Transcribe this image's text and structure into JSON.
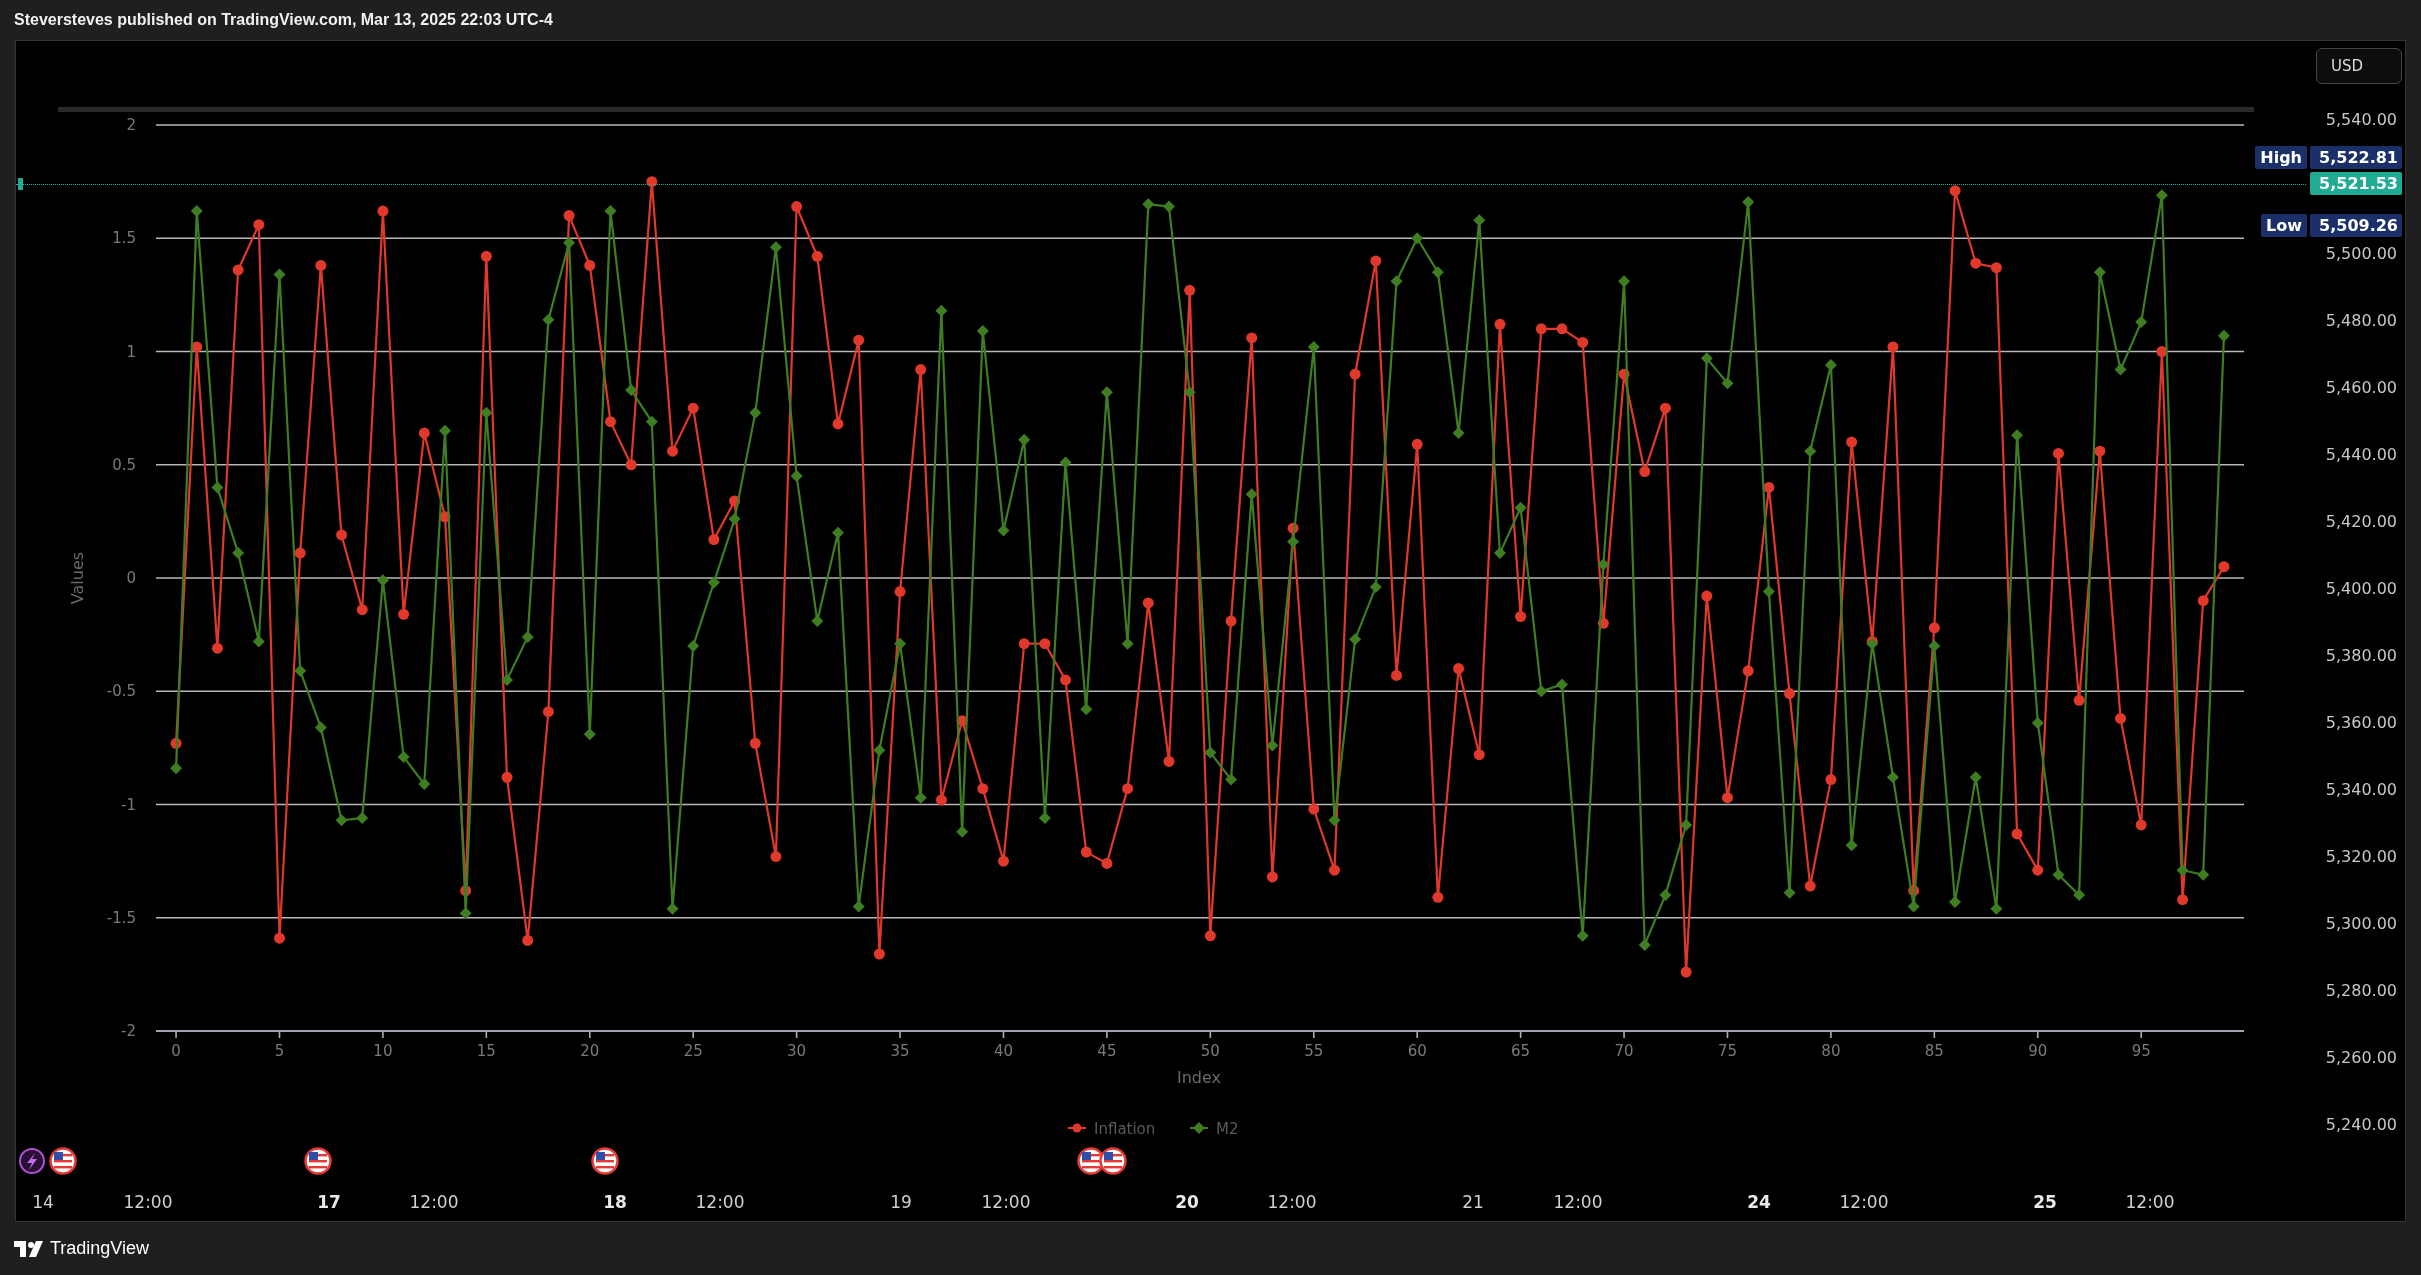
{
  "header": {
    "published": "Steversteves published on TradingView.com, Mar 13, 2025 22:03 UTC-4"
  },
  "chart": {
    "chart_data": {
      "type": "line",
      "xlabel": "Index",
      "ylabel": "Values",
      "xlim": [
        -0.97,
        99.97
      ],
      "ylim": [
        -2,
        2
      ],
      "grid": true,
      "legend": "bottom",
      "x": [
        0,
        1,
        2,
        3,
        4,
        5,
        6,
        7,
        8,
        9,
        10,
        11,
        12,
        13,
        14,
        15,
        16,
        17,
        18,
        19,
        20,
        21,
        22,
        23,
        24,
        25,
        26,
        27,
        28,
        29,
        30,
        31,
        32,
        33,
        34,
        35,
        36,
        37,
        38,
        39,
        40,
        41,
        42,
        43,
        44,
        45,
        46,
        47,
        48,
        49,
        50,
        51,
        52,
        53,
        54,
        55,
        56,
        57,
        58,
        59,
        60,
        61,
        62,
        63,
        64,
        65,
        66,
        67,
        68,
        69,
        70,
        71,
        72,
        73,
        74,
        75,
        76,
        77,
        78,
        79,
        80,
        81,
        82,
        83,
        84,
        85,
        86,
        87,
        88,
        89,
        90,
        91,
        92,
        93,
        94,
        95,
        96,
        97,
        98,
        99
      ],
      "xticks": [
        0,
        5,
        10,
        15,
        20,
        25,
        30,
        35,
        40,
        45,
        50,
        55,
        60,
        65,
        70,
        75,
        80,
        85,
        90,
        95
      ],
      "yticks": [
        -2,
        -1.5,
        -1,
        -0.5,
        0,
        0.5,
        1,
        1.5,
        2
      ],
      "series": [
        {
          "name": "Inflation",
          "color": "#e0392b",
          "marker": "circle",
          "values": [
            -0.73,
            1.02,
            -0.31,
            1.36,
            1.56,
            -1.59,
            0.11,
            1.38,
            0.19,
            -0.14,
            1.62,
            -0.16,
            0.64,
            0.27,
            -1.38,
            1.42,
            -0.88,
            -1.6,
            -0.59,
            1.6,
            1.38,
            0.69,
            0.5,
            1.75,
            0.56,
            0.75,
            0.17,
            0.34,
            -0.73,
            -1.23,
            1.64,
            1.42,
            0.68,
            1.05,
            -1.66,
            -0.06,
            0.92,
            -0.98,
            -0.63,
            -0.93,
            -1.25,
            -0.29,
            -0.29,
            -0.45,
            -1.21,
            -1.26,
            -0.93,
            -0.11,
            -0.81,
            1.27,
            -1.58,
            -0.19,
            1.06,
            -1.32,
            0.22,
            -1.02,
            -1.29,
            0.9,
            1.4,
            -0.43,
            0.59,
            -1.41,
            -0.4,
            -0.78,
            1.12,
            -0.17,
            1.1,
            1.1,
            1.04,
            -0.2,
            0.9,
            0.47,
            0.75,
            -1.74,
            -0.08,
            -0.97,
            -0.41,
            0.4,
            -0.51,
            -1.36,
            -0.89,
            0.6,
            -0.28,
            1.02,
            -1.38,
            -0.22,
            1.71,
            1.39,
            1.37,
            -1.13,
            -1.29,
            0.55,
            -0.54,
            0.56,
            -0.62,
            -1.09,
            1.0,
            -1.42,
            -0.1,
            0.05
          ]
        },
        {
          "name": "M2",
          "color": "#3e7d22",
          "marker": "diamond",
          "values": [
            -0.84,
            1.62,
            0.4,
            0.11,
            -0.28,
            1.34,
            -0.41,
            -0.66,
            -1.07,
            -1.06,
            -0.01,
            -0.79,
            -0.91,
            0.65,
            -1.48,
            0.73,
            -0.45,
            -0.26,
            1.14,
            1.48,
            -0.69,
            1.62,
            0.83,
            0.69,
            -1.46,
            -0.3,
            -0.02,
            0.26,
            0.73,
            1.46,
            0.45,
            -0.19,
            0.2,
            -1.45,
            -0.76,
            -0.29,
            -0.97,
            1.18,
            -1.12,
            1.09,
            0.21,
            0.61,
            -1.06,
            0.51,
            -0.58,
            0.82,
            -0.29,
            1.65,
            1.64,
            0.82,
            -0.77,
            -0.89,
            0.37,
            -0.74,
            0.16,
            1.02,
            -1.07,
            -0.27,
            -0.04,
            1.31,
            1.5,
            1.35,
            0.64,
            1.58,
            0.11,
            0.31,
            -0.5,
            -0.47,
            -1.58,
            0.06,
            1.31,
            -1.62,
            -1.4,
            -1.09,
            0.97,
            0.86,
            1.66,
            -0.06,
            -1.39,
            0.56,
            0.94,
            -1.18,
            -0.29,
            -0.88,
            -1.45,
            -0.3,
            -1.43,
            -0.88,
            -1.46,
            0.63,
            -0.64,
            -1.31,
            -1.4,
            1.35,
            0.92,
            1.13,
            1.69,
            -1.29,
            -1.31,
            1.07
          ]
        }
      ]
    }
  },
  "time_axis": [
    {
      "label": "14",
      "bold": false
    },
    {
      "label": "12:00",
      "bold": false
    },
    {
      "label": "17",
      "bold": true
    },
    {
      "label": "12:00",
      "bold": false
    },
    {
      "label": "18",
      "bold": true
    },
    {
      "label": "12:00",
      "bold": false
    },
    {
      "label": "19",
      "bold": false
    },
    {
      "label": "12:00",
      "bold": false
    },
    {
      "label": "20",
      "bold": true
    },
    {
      "label": "12:00",
      "bold": false
    },
    {
      "label": "21",
      "bold": false
    },
    {
      "label": "12:00",
      "bold": false
    },
    {
      "label": "24",
      "bold": true
    },
    {
      "label": "12:00",
      "bold": false
    },
    {
      "label": "25",
      "bold": true
    },
    {
      "label": "12:00",
      "bold": false
    }
  ],
  "price_axis": {
    "currency": "USD",
    "labels": [
      "5,540.00",
      "5,500.00",
      "5,480.00",
      "5,460.00",
      "5,440.00",
      "5,420.00",
      "5,400.00",
      "5,380.00",
      "5,360.00",
      "5,340.00",
      "5,320.00",
      "5,300.00",
      "5,280.00",
      "5,260.00",
      "5,240.00"
    ],
    "high": {
      "label": "High",
      "value": "5,522.81"
    },
    "last": {
      "value": "5,521.53"
    },
    "low": {
      "label": "Low",
      "value": "5,509.26"
    }
  },
  "footer": {
    "brand": "TradingView"
  }
}
